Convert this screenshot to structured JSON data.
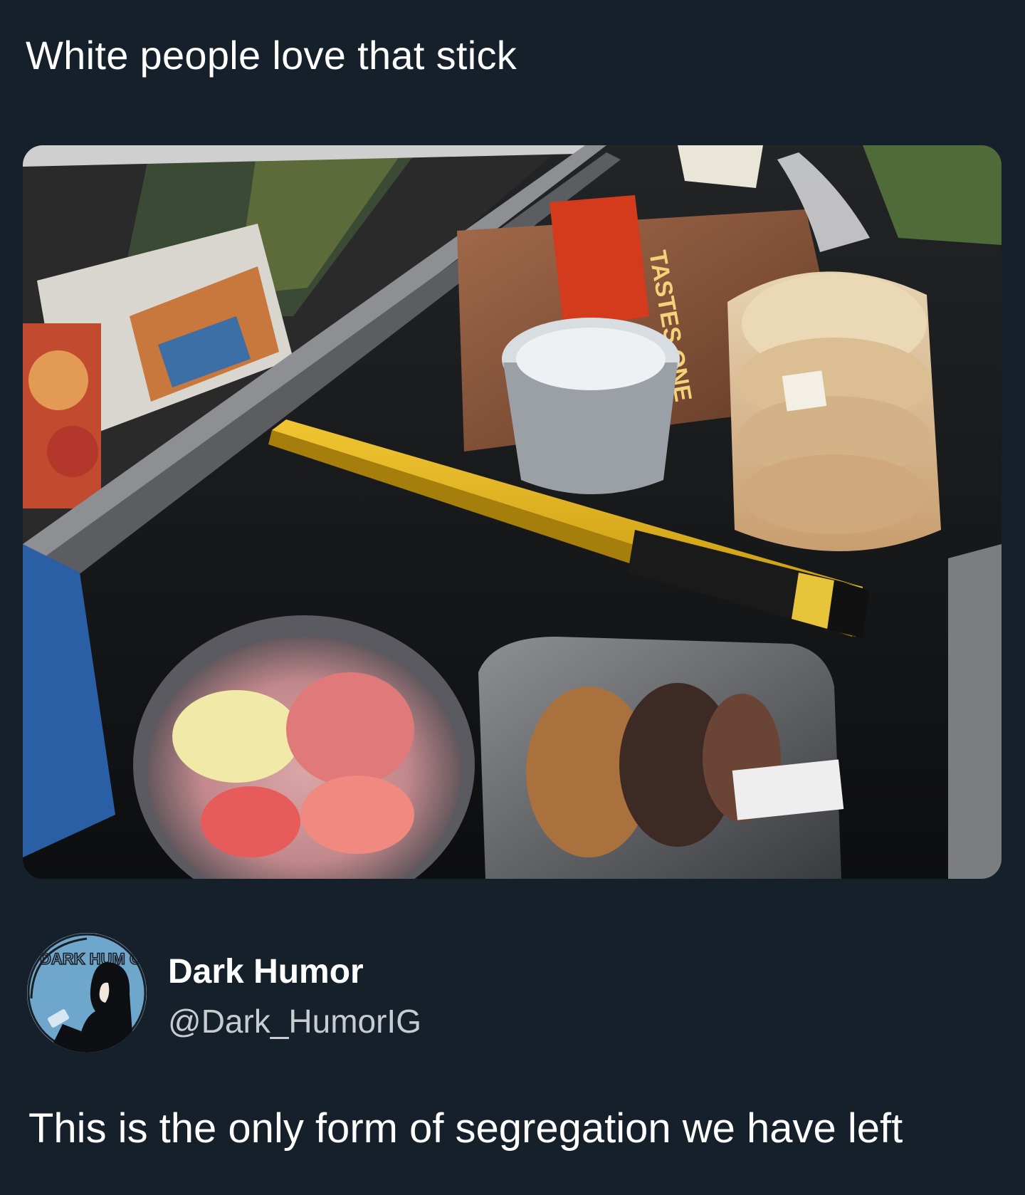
{
  "post": {
    "caption_top": "White people love that stick",
    "caption_bottom": "This is the only form of segregation we have left"
  },
  "author": {
    "name": "Dark Humor",
    "handle": "@Dark_HumorIG",
    "avatar_text": "DARK HUM OR"
  },
  "photo": {
    "scene": "grocery checkout conveyor belt with a divider bar",
    "bread_brand": "TASTES ONE"
  },
  "colors": {
    "background": "#15202b",
    "text": "#ffffff",
    "handle": "#c8ccd1",
    "avatar_bg": "#6fa6cc"
  }
}
